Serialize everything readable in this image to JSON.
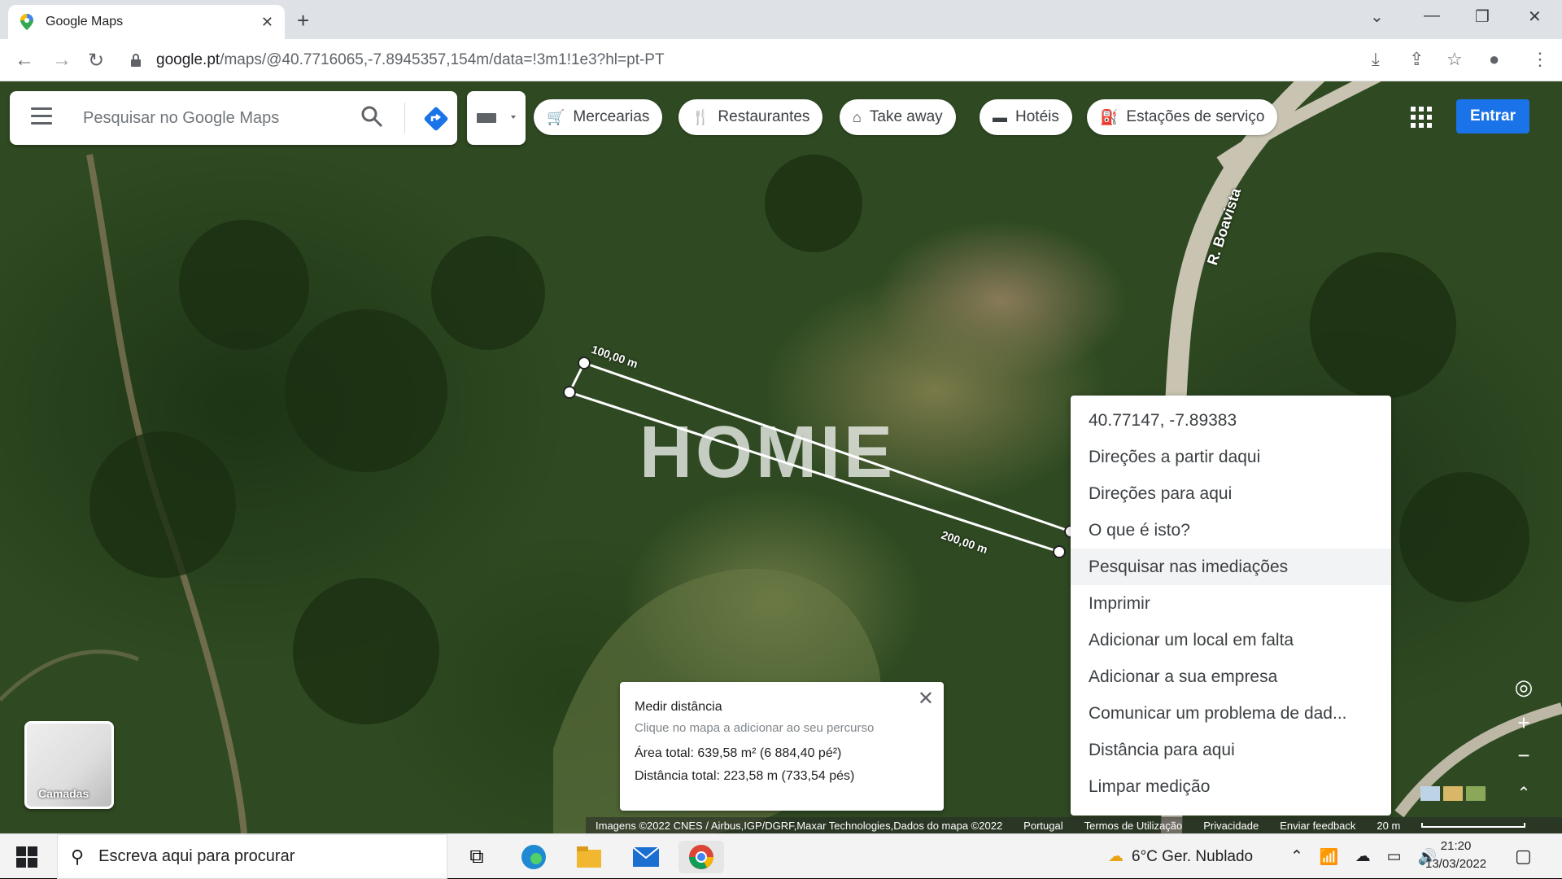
{
  "browser": {
    "tab_title": "Google Maps",
    "url_host": "google.pt",
    "url_path": "/maps/@40.7716065,-7.8945357,154m/data=!3m1!1e3?hl=pt-PT"
  },
  "maps": {
    "search_placeholder": "Pesquisar no Google Maps",
    "chips": [
      {
        "label": "Mercearias",
        "icon": "cart-icon"
      },
      {
        "label": "Restaurantes",
        "icon": "cutlery-icon"
      },
      {
        "label": "Take away",
        "icon": "takeaway-bag-icon"
      },
      {
        "label": "Hotéis",
        "icon": "bed-icon"
      },
      {
        "label": "Estações de serviço",
        "icon": "gas-station-icon"
      }
    ],
    "sign_in": "Entrar",
    "road_label": "R. Boavista",
    "watermark": "HOMIE",
    "measure_labels": {
      "first": "100,00 m",
      "second": "200,00 m"
    },
    "context_menu": [
      "40.77147, -7.89383",
      "Direções a partir daqui",
      "Direções para aqui",
      "O que é isto?",
      "Pesquisar nas imediações",
      "Imprimir",
      "Adicionar um local em falta",
      "Adicionar a sua empresa",
      "Comunicar um problema de dad...",
      "Distância para aqui",
      "Limpar medição"
    ],
    "measure_panel": {
      "title": "Medir distância",
      "hint": "Clique no mapa a adicionar ao seu percurso",
      "area": "Área total: 639,58 m² (6 884,40 pé²)",
      "distance": "Distância total: 223,58 m (733,54 pés)"
    },
    "layers_label": "Camadas",
    "footer": {
      "imagery": "Imagens ©2022 CNES / Airbus,IGP/DGRF,Maxar Technologies,Dados do mapa ©2022",
      "country": "Portugal",
      "terms": "Termos de Utilização",
      "privacy": "Privacidade",
      "feedback": "Enviar feedback",
      "scale": "20 m"
    }
  },
  "taskbar": {
    "search_placeholder": "Escreva aqui para procurar",
    "weather": "6°C  Ger. Nublado",
    "time": "21:20",
    "date": "13/03/2022"
  },
  "colors": {
    "accent": "#1a73e8",
    "map_base": "#2f4a22"
  }
}
